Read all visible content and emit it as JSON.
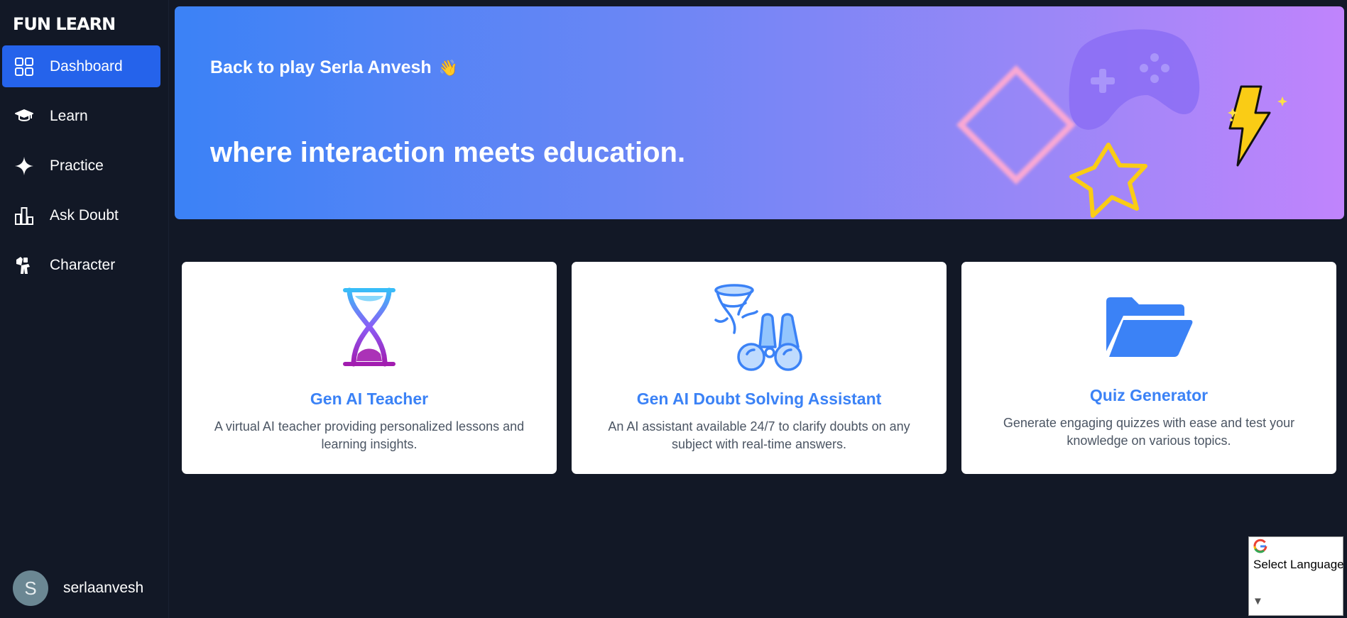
{
  "app": {
    "brand": "FUN LEARN"
  },
  "sidebar": {
    "items": [
      {
        "label": "Dashboard",
        "icon": "grid-icon",
        "active": true
      },
      {
        "label": "Learn",
        "icon": "graduation-cap-icon",
        "active": false
      },
      {
        "label": "Practice",
        "icon": "sparkle-icon",
        "active": false
      },
      {
        "label": "Ask Doubt",
        "icon": "bar-chart-icon",
        "active": false
      },
      {
        "label": "Character",
        "icon": "shirt-icon",
        "active": false
      }
    ],
    "user": {
      "initial": "S",
      "name": "serlaanvesh"
    }
  },
  "banner": {
    "greeting": "Back to play Serla Anvesh",
    "wave": "👋",
    "tagline": "where interaction meets education."
  },
  "cards": [
    {
      "title": "Gen AI Teacher",
      "description": "A virtual AI teacher providing personalized lessons and learning insights.",
      "icon": "hourglass-icon"
    },
    {
      "title": "Gen AI Doubt Solving Assistant",
      "description": "An AI assistant available 24/7 to clarify doubts on any subject with real-time answers.",
      "icon": "binoculars-icon"
    },
    {
      "title": "Quiz Generator",
      "description": "Generate engaging quizzes with ease and test your knowledge on various topics.",
      "icon": "folder-icon"
    }
  ],
  "language_widget": {
    "label": "Select Language",
    "arrow": "▼"
  },
  "colors": {
    "background": "#121826",
    "active_nav": "#2563eb",
    "accent": "#3b82f6",
    "banner_start": "#3b82f6",
    "banner_end": "#c084fc"
  }
}
